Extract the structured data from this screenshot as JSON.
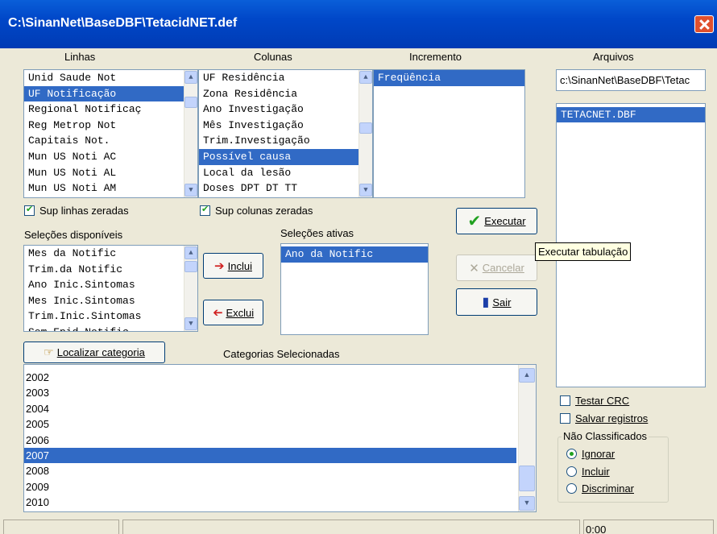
{
  "window": {
    "title": "C:\\SinanNet\\BaseDBF\\TetacidNET.def"
  },
  "linhas": {
    "label": "Linhas",
    "items": [
      "Unid Saude Not",
      "UF Notificação",
      "Regional Notificaç",
      "Reg Metrop Not",
      "Capitais Not.",
      "Mun US Noti AC",
      "Mun US Noti AL",
      "Mun US Noti AM"
    ],
    "selected_index": 1
  },
  "colunas": {
    "label": "Colunas",
    "items": [
      "UF Residência",
      "Zona Residência",
      "Ano Investigação",
      "Mês Investigação",
      "Trim.Investigação",
      "Possível causa",
      "Local da lesão",
      "Doses DPT DT TT"
    ],
    "selected_index": 5
  },
  "incremento": {
    "label": "Incremento",
    "items": [
      "Freqüência"
    ]
  },
  "arquivos": {
    "label": "Arquivos",
    "path_value": "c:\\SinanNet\\BaseDBF\\Tetac",
    "files": [
      "TETACNET.DBF"
    ]
  },
  "checkboxes": {
    "sup_linhas": {
      "label": "Sup linhas zeradas",
      "checked": true
    },
    "sup_colunas": {
      "label": "Sup colunas zeradas",
      "checked": true
    }
  },
  "selecoes_disponiveis": {
    "label": "Seleções disponíveis",
    "items": [
      "Mes da Notific",
      "Trim.da Notific",
      "Ano Inic.Sintomas",
      "Mes Inic.Sintomas",
      "Trim.Inic.Sintomas",
      "Sem.Epid.Notific"
    ]
  },
  "selecoes_ativas": {
    "label": "Seleções ativas",
    "items": [
      "Ano da Notific"
    ]
  },
  "buttons": {
    "inclui": "Inclui",
    "exclui": "Exclui",
    "executar": "Executar",
    "cancelar": "Cancelar",
    "sair": "Sair",
    "localizar": "Localizar categoria"
  },
  "tooltip": "Executar tabulação",
  "categorias": {
    "label": "Categorias Selecionadas",
    "items": [
      "2002",
      "2003",
      "2004",
      "2005",
      "2006",
      "2007",
      "2008",
      "2009",
      "2010"
    ],
    "selected_index": 5
  },
  "options": {
    "testar_crc": {
      "label": "Testar CRC",
      "checked": false
    },
    "salvar_registros": {
      "label": "Salvar registros",
      "checked": false
    }
  },
  "nao_classificados": {
    "label": "Não Classificados",
    "options": [
      "Ignorar",
      "Incluir",
      "Discriminar"
    ],
    "selected_index": 0
  },
  "status": {
    "time": "0:00"
  },
  "colors": {
    "selection": "#316ac5",
    "title_bar": "#0047c8",
    "dialog_bg": "#ece9d8"
  }
}
